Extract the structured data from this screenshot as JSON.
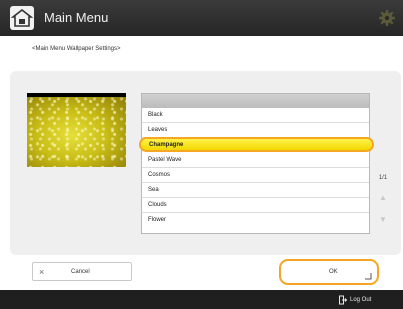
{
  "header": {
    "title": "Main Menu",
    "icons": {
      "home": "home-icon",
      "settings": "gear-icon"
    }
  },
  "breadcrumb": "<Main Menu Wallpaper Settings>",
  "wallpaper_list": {
    "items": [
      "Black",
      "Leaves",
      "Champagne",
      "Pastel Wave",
      "Cosmos",
      "Sea",
      "Clouds",
      "Flower"
    ],
    "selected": "Champagne",
    "page": "1/1"
  },
  "buttons": {
    "cancel": "Cancel",
    "ok": "OK"
  },
  "footer": {
    "logout": "Log Out"
  },
  "colors": {
    "accent": "#f5a623",
    "selected_bg": "#f7e21a",
    "header_bg": "#2f2f2f"
  }
}
